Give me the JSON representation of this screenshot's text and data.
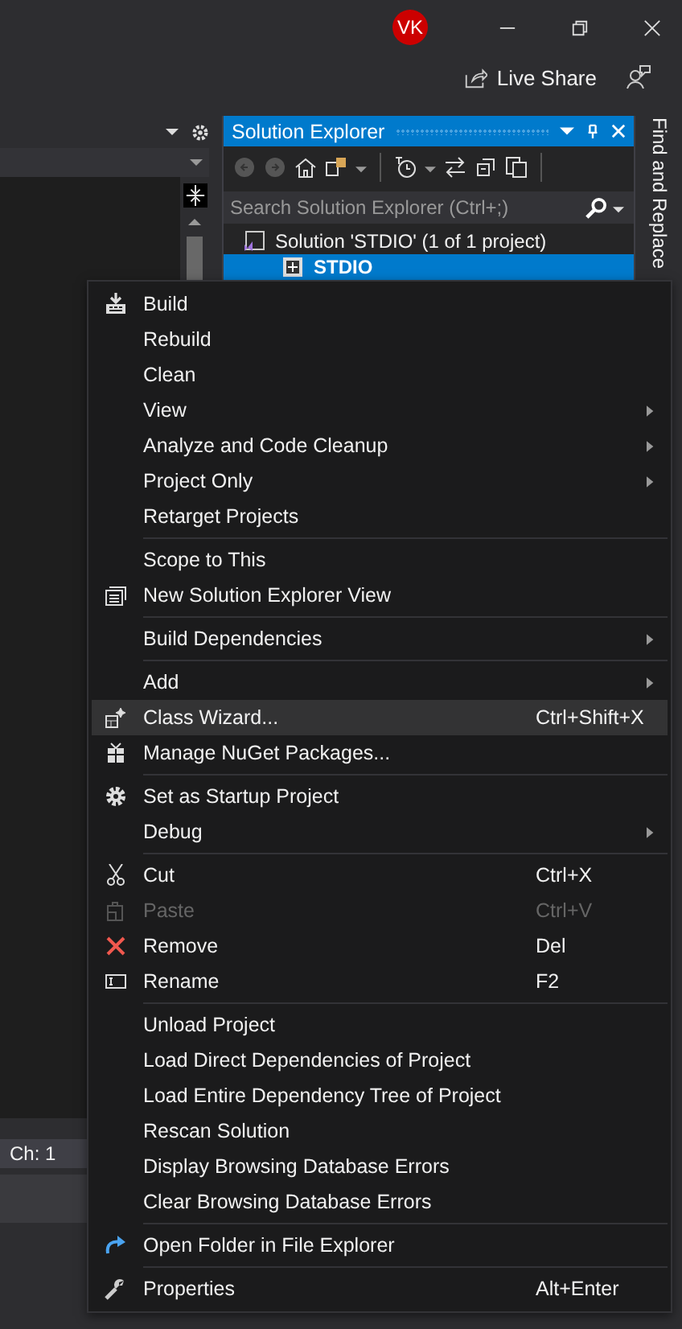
{
  "title_bar": {
    "avatar": "VK",
    "live_share": "Live Share"
  },
  "solution_explorer": {
    "title": "Solution Explorer",
    "search": {
      "placeholder": "Search Solution Explorer (Ctrl+;)"
    },
    "tree": [
      {
        "label": "Solution 'STDIO' (1 of 1 project)",
        "selected": false
      },
      {
        "label": "STDIO",
        "selected": true
      }
    ]
  },
  "side_tab": "Find and Replace",
  "status": {
    "column": "Ch: 1"
  },
  "context_menu": {
    "groups": [
      [
        {
          "label": "Build",
          "submenu": false,
          "disabled": false,
          "selected": false
        },
        {
          "label": "Rebuild",
          "submenu": false,
          "disabled": false,
          "selected": false
        },
        {
          "label": "Clean",
          "submenu": false,
          "disabled": false,
          "selected": false
        },
        {
          "label": "View",
          "submenu": true,
          "disabled": false,
          "selected": false
        },
        {
          "label": "Analyze and Code Cleanup",
          "submenu": true,
          "disabled": false,
          "selected": false
        },
        {
          "label": "Project Only",
          "submenu": true,
          "disabled": false,
          "selected": false
        },
        {
          "label": "Retarget Projects",
          "submenu": false,
          "disabled": false,
          "selected": false
        }
      ],
      [
        {
          "label": "Scope to This",
          "submenu": false,
          "disabled": false,
          "selected": false
        },
        {
          "label": "New Solution Explorer View",
          "submenu": false,
          "disabled": false,
          "selected": false
        }
      ],
      [
        {
          "label": "Build Dependencies",
          "submenu": true,
          "disabled": false,
          "selected": false
        }
      ],
      [
        {
          "label": "Add",
          "submenu": true,
          "disabled": false,
          "selected": false
        },
        {
          "label": "Class Wizard...",
          "shortcut": "Ctrl+Shift+X",
          "submenu": false,
          "disabled": false,
          "selected": true
        },
        {
          "label": "Manage NuGet Packages...",
          "submenu": false,
          "disabled": false,
          "selected": false
        }
      ],
      [
        {
          "label": "Set as Startup Project",
          "submenu": false,
          "disabled": false,
          "selected": false
        },
        {
          "label": "Debug",
          "submenu": true,
          "disabled": false,
          "selected": false
        }
      ],
      [
        {
          "label": "Cut",
          "shortcut": "Ctrl+X",
          "submenu": false,
          "disabled": false,
          "selected": false
        },
        {
          "label": "Paste",
          "shortcut": "Ctrl+V",
          "submenu": false,
          "disabled": true,
          "selected": false
        },
        {
          "label": "Remove",
          "shortcut": "Del",
          "submenu": false,
          "disabled": false,
          "selected": false
        },
        {
          "label": "Rename",
          "shortcut": "F2",
          "submenu": false,
          "disabled": false,
          "selected": false
        }
      ],
      [
        {
          "label": "Unload Project",
          "submenu": false,
          "disabled": false,
          "selected": false
        },
        {
          "label": "Load Direct Dependencies of Project",
          "submenu": false,
          "disabled": false,
          "selected": false
        },
        {
          "label": "Load Entire Dependency Tree of Project",
          "submenu": false,
          "disabled": false,
          "selected": false
        },
        {
          "label": "Rescan Solution",
          "submenu": false,
          "disabled": false,
          "selected": false
        },
        {
          "label": "Display Browsing Database Errors",
          "submenu": false,
          "disabled": false,
          "selected": false
        },
        {
          "label": "Clear Browsing Database Errors",
          "submenu": false,
          "disabled": false,
          "selected": false
        }
      ],
      [
        {
          "label": "Open Folder in File Explorer",
          "submenu": false,
          "disabled": false,
          "selected": false
        }
      ],
      [
        {
          "label": "Properties",
          "shortcut": "Alt+Enter",
          "submenu": false,
          "disabled": false,
          "selected": false
        }
      ]
    ]
  }
}
